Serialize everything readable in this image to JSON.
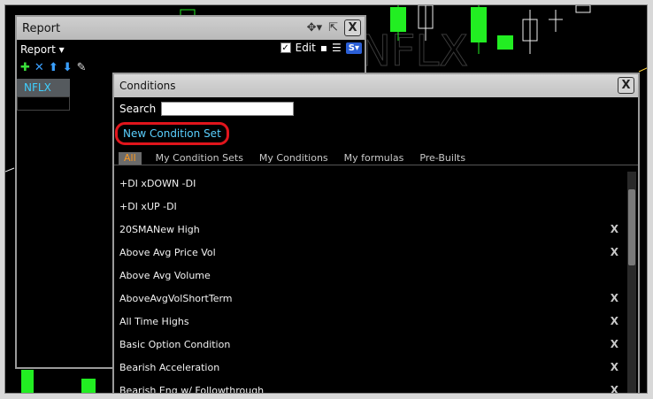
{
  "background_ticker": "NFLX",
  "report": {
    "title": "Report",
    "dropdown_label": "Report ▾",
    "edit_label": "Edit",
    "s_button": "S▾",
    "ticker": "NFLX",
    "close": "X"
  },
  "conditions": {
    "title": "Conditions",
    "close": "X",
    "search_label": "Search",
    "search_value": "",
    "new_condition_set": "New Condition Set",
    "tabs": [
      "All",
      "My Condition Sets",
      "My Conditions",
      "My formulas",
      "Pre-Builts"
    ],
    "active_tab": "All",
    "items": [
      {
        "label": "+DI xDOWN -DI",
        "deletable": false
      },
      {
        "label": "+DI xUP -DI",
        "deletable": false
      },
      {
        "label": "20SMANew High",
        "deletable": true
      },
      {
        "label": "Above Avg Price Vol",
        "deletable": true
      },
      {
        "label": "Above Avg Volume",
        "deletable": false
      },
      {
        "label": "AboveAvgVolShortTerm",
        "deletable": true
      },
      {
        "label": "All Time Highs",
        "deletable": true
      },
      {
        "label": "Basic Option Condition",
        "deletable": true
      },
      {
        "label": "Bearish Acceleration",
        "deletable": true
      },
      {
        "label": "Bearish Eng w/ Followthrough",
        "deletable": true
      }
    ],
    "delete_glyph": "X"
  },
  "colors": {
    "accent_link": "#5ad0ff",
    "highlight_ring": "#e0151c",
    "active_tab_text": "#ff9a1f",
    "candle_green": "#22ee22"
  }
}
